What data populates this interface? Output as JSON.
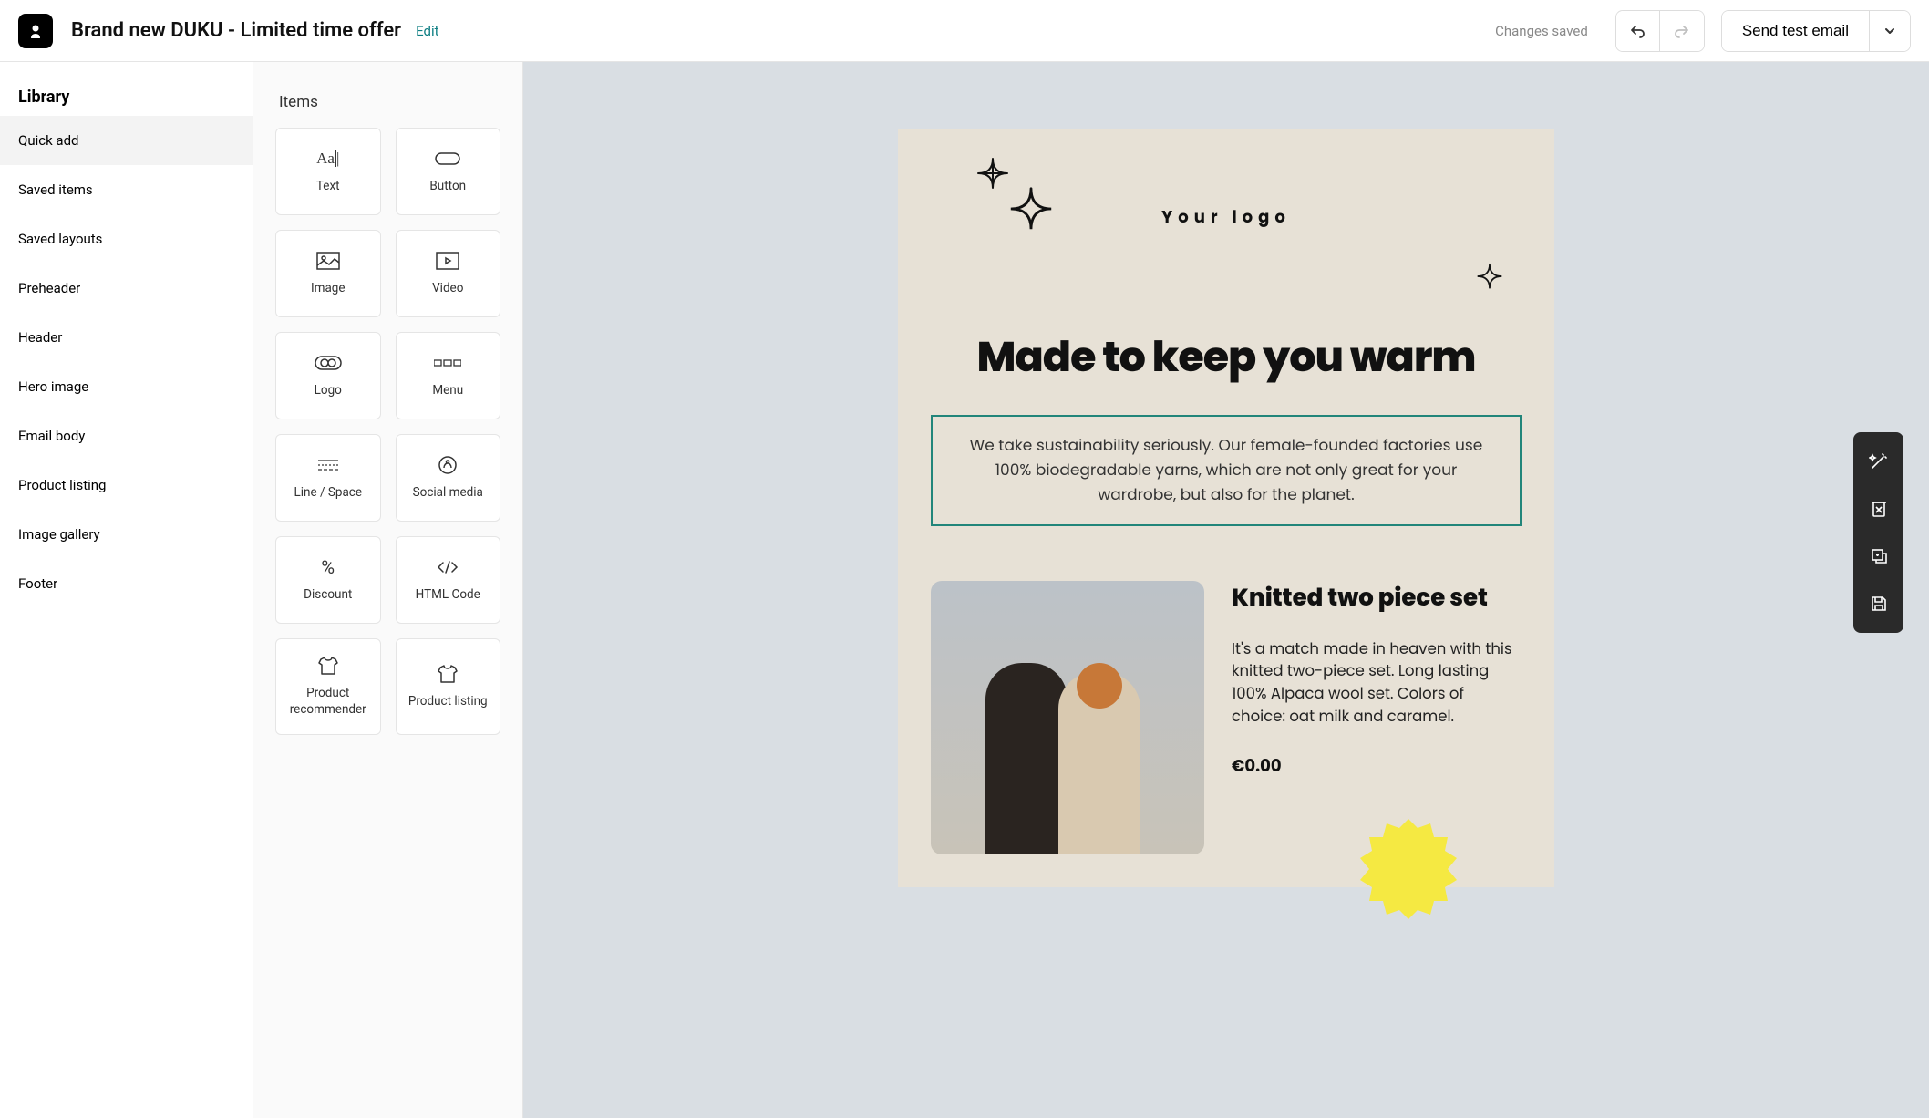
{
  "header": {
    "title": "Brand new DUKU - Limited time offer",
    "edit": "Edit",
    "saved": "Changes saved",
    "send": "Send test email"
  },
  "sidebar": {
    "title": "Library",
    "items": [
      {
        "label": "Quick add",
        "active": true
      },
      {
        "label": "Saved items"
      },
      {
        "label": "Saved layouts"
      },
      {
        "label": "Preheader"
      },
      {
        "label": "Header"
      },
      {
        "label": "Hero image"
      },
      {
        "label": "Email body"
      },
      {
        "label": "Product listing"
      },
      {
        "label": "Image gallery"
      },
      {
        "label": "Footer"
      }
    ]
  },
  "items": {
    "title": "Items",
    "cards": [
      {
        "label": "Text",
        "icon": "text"
      },
      {
        "label": "Button",
        "icon": "button"
      },
      {
        "label": "Image",
        "icon": "image"
      },
      {
        "label": "Video",
        "icon": "video"
      },
      {
        "label": "Logo",
        "icon": "logo"
      },
      {
        "label": "Menu",
        "icon": "menu"
      },
      {
        "label": "Line / Space",
        "icon": "line"
      },
      {
        "label": "Social media",
        "icon": "social"
      },
      {
        "label": "Discount",
        "icon": "discount"
      },
      {
        "label": "HTML Code",
        "icon": "html"
      },
      {
        "label": "Product recommender",
        "icon": "tshirt"
      },
      {
        "label": "Product listing",
        "icon": "tshirt"
      }
    ]
  },
  "email": {
    "logo": "Your logo",
    "headline": "Made to keep you warm",
    "subtext": "We take sustainability seriously. Our female-founded factories use 100% biodegradable yarns, which are not only great for your wardrobe, but also for the planet.",
    "product": {
      "title": "Knitted two piece set",
      "desc": "It's a match made in heaven with this knitted two-piece set. Long lasting 100% Alpaca wool set. Colors of choice: oat milk and caramel.",
      "price": "€0.00"
    }
  }
}
